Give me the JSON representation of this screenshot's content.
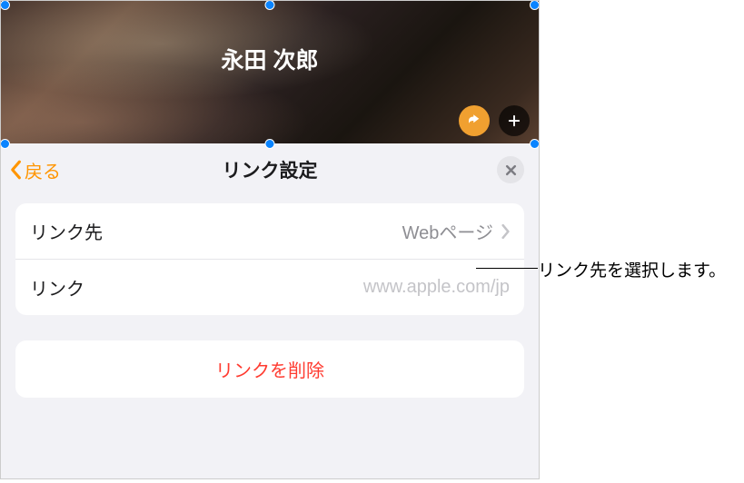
{
  "header": {
    "title": "永田 次郎"
  },
  "panel": {
    "back_label": "戻る",
    "title": "リンク設定",
    "rows": {
      "link_target": {
        "label": "リンク先",
        "value": "Webページ"
      },
      "link": {
        "label": "リンク",
        "placeholder": "www.apple.com/jp"
      }
    },
    "delete_label": "リンクを削除"
  },
  "callout": {
    "text": "リンク先を選択します。"
  }
}
